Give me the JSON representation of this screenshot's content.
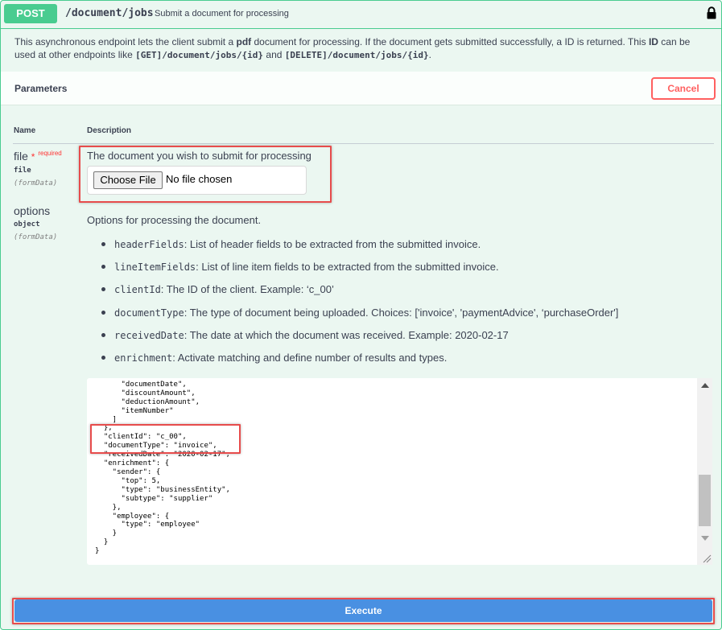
{
  "operation": {
    "method": "POST",
    "path": "/document/jobs",
    "summary": "Submit a document for processing",
    "description": {
      "p1": "This asynchronous endpoint lets the client submit a ",
      "pdf": "pdf",
      "p2": " document for processing. If the document gets submitted successfully, a ID is returned. This ",
      "id": "ID",
      "p3": " can be used at other endpoints like ",
      "code1": "[GET]/document/jobs/{id}",
      "and": " and ",
      "code2": "[DELETE]/document/jobs/{id}",
      "end": "."
    }
  },
  "parameters": {
    "title": "Parameters",
    "cancel_label": "Cancel",
    "col_name": "Name",
    "col_description": "Description",
    "file": {
      "name": "file",
      "required_mark": "*",
      "required_text": "required",
      "type": "file",
      "in": "(formData)",
      "description": "The document you wish to submit for processing",
      "choose_label": "Choose File",
      "no_file": "No file chosen"
    },
    "options": {
      "name": "options",
      "type": "object",
      "in": "(formData)",
      "description": "Options for processing the document.",
      "items": [
        {
          "key": "headerFields",
          "text": ": List of header fields to be extracted from the submitted invoice."
        },
        {
          "key": "lineItemFields",
          "text": ": List of line item fields to be extracted from the submitted invoice."
        },
        {
          "key": "clientId",
          "text": ": The ID of the client. Example: ‘c_00’"
        },
        {
          "key": "documentType",
          "text": ": The type of document being uploaded. Choices: ['invoice', 'paymentAdvice', ‘purchaseOrder']"
        },
        {
          "key": "receivedDate",
          "text": ": The date at which the document was received. Example: 2020-02-17"
        },
        {
          "key": "enrichment",
          "text": ": Activate matching and define number of results and types."
        }
      ],
      "json_value": "      \"documentNumber\",\n      \"documentDate\",\n      \"discountAmount\",\n      \"deductionAmount\",\n      \"itemNumber\"\n    ]\n  },\n  \"clientId\": \"c_00\",\n  \"documentType\": \"invoice\",\n  \"receivedDate\": \"2020-02-17\",\n  \"enrichment\": {\n    \"sender\": {\n      \"top\": 5,\n      \"type\": \"businessEntity\",\n      \"subtype\": \"supplier\"\n    },\n    \"employee\": {\n      \"type\": \"employee\"\n    }\n  }\n}"
    }
  },
  "execute_label": "Execute",
  "colors": {
    "post_green": "#49cc90",
    "cancel_red": "#ff6060",
    "execute_blue": "#4990e2",
    "highlight_red": "#e74c4c"
  },
  "icons": [
    "lock-icon",
    "scrollbar-up-icon",
    "scrollbar-down-icon",
    "resize-grip-icon"
  ]
}
